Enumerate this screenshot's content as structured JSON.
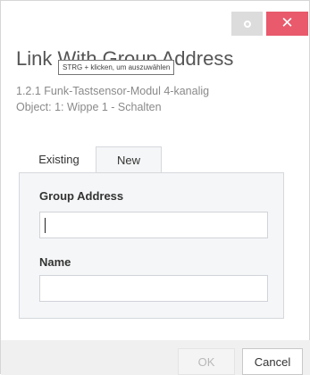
{
  "window": {
    "restore_icon": "restore-icon",
    "close_icon": "close-icon",
    "close_glyph": "✕",
    "close_color": "#e85a6c"
  },
  "dialog": {
    "title": "Link With Group Address",
    "tooltip": "STRG + klicken, um auszuwählen",
    "device": "1.2.1 Funk-Tastsensor-Modul  4-kanalig",
    "object": "Object: 1: Wippe 1 - Schalten"
  },
  "tabs": {
    "existing": "Existing",
    "new": "New",
    "active": "New"
  },
  "form": {
    "group_address_label": "Group Address",
    "group_address_value": "",
    "name_label": "Name",
    "name_value": ""
  },
  "buttons": {
    "ok": "OK",
    "cancel": "Cancel"
  }
}
